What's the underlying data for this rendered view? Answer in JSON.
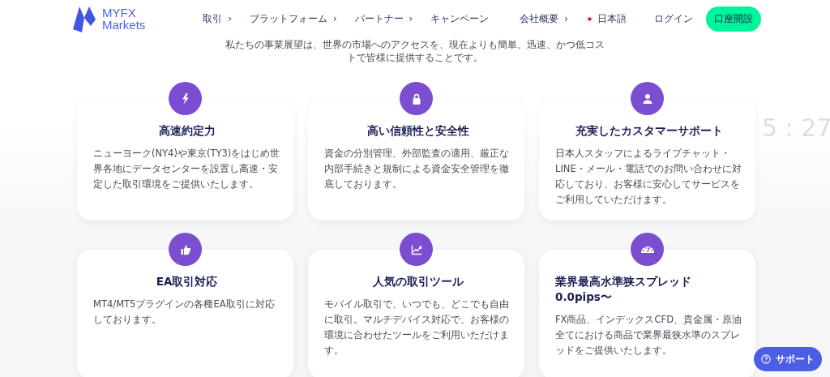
{
  "header": {
    "logo": {
      "line_1": "MYFX",
      "line_2": "Markets"
    },
    "nav": [
      {
        "label": "取引",
        "chevron": "›"
      },
      {
        "label": "プラットフォーム",
        "chevron": "›"
      },
      {
        "label": "パートナー",
        "chevron": "›"
      },
      {
        "label": "キャンペーン"
      },
      {
        "label": "会社概要",
        "chevron": "›"
      }
    ],
    "language": "日本語",
    "login": "ログイン",
    "signup": "口座開設"
  },
  "intro": "私たちの事業展望は、世界の市場へのアクセスを、現在よりも簡単、迅速、かつ低コストで皆様に提供することです。",
  "features": [
    {
      "title": "高速約定力",
      "text": "ニューヨーク(NY4)や東京(TY3)をはじめ世界各地にデータセンターを設置し高速・安定した取引環境をご提供いたします。"
    },
    {
      "title": "高い信頼性と安全性",
      "text": "資金の分別管理、外部監査の適用、厳正な内部手続きと規制による資金安全管理を徹底しております。"
    },
    {
      "title": "充実したカスタマーサポート",
      "text": "日本人スタッフによるライブチャット・LINE・メール・電話でのお問い合わせに対応しており、お客様に安心してサービスをご利用していただけます。"
    },
    {
      "title": "EA取引対応",
      "text": "MT4/MT5プラグインの各種EA取引に対応しております。"
    },
    {
      "title": "人気の取引ツール",
      "text": "モバイル取引で、いつでも、どこでも自由に取引。マルチデバイス対応で、お客様の環境に合わせたツールをご利用いただけます。"
    },
    {
      "title": "業界最高水準狭スプレッド0.0pips〜",
      "text": "FX商品、インデックスCFD、貴金属・原油全てにおける商品で業界最狭水準のスプレッドをご提供いたします。"
    }
  ],
  "clock_overlay": "5 : 27",
  "support_button": "サポート"
}
